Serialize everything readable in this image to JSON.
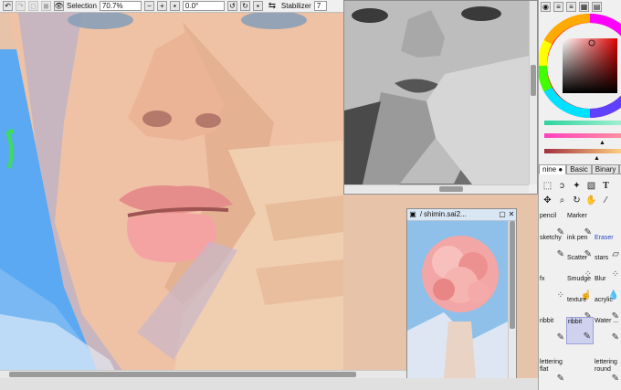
{
  "toolbar": {
    "selection_label": "Selection",
    "zoom": "70.7%",
    "rotation": "0.0°",
    "stabilizer_label": "Stabilizer",
    "stabilizer_value": "7"
  },
  "navigator": {
    "title": "shimin.sai2..."
  },
  "panel": {
    "tabs": [
      "nine ●",
      "Basic",
      "Binary",
      "Ve"
    ],
    "brushes": [
      {
        "label": "pencil",
        "glyph": "✎"
      },
      {
        "label": "Marker",
        "glyph": "✎"
      },
      {
        "label": "",
        "glyph": ""
      },
      {
        "label": "sketchy",
        "glyph": "✎"
      },
      {
        "label": "ink pen",
        "glyph": "✎"
      },
      {
        "label": "Eraser",
        "glyph": "▱"
      },
      {
        "label": "",
        "glyph": ""
      },
      {
        "label": "Scatter",
        "glyph": "⁘"
      },
      {
        "label": "stars",
        "glyph": "⁘"
      },
      {
        "label": "fx",
        "glyph": "⁘"
      },
      {
        "label": "Smudge",
        "glyph": "☝"
      },
      {
        "label": "Blur",
        "glyph": "💧"
      },
      {
        "label": "",
        "glyph": ""
      },
      {
        "label": "texture",
        "glyph": "✎"
      },
      {
        "label": "acrylic",
        "glyph": "✎"
      },
      {
        "label": "ribbit",
        "glyph": "✎"
      },
      {
        "label": "ribbit",
        "glyph": "✎"
      },
      {
        "label": "Water ...",
        "glyph": "✎"
      },
      {
        "label": "lettering flat",
        "glyph": "✎"
      },
      {
        "label": "",
        "glyph": ""
      },
      {
        "label": "lettering round",
        "glyph": "✎"
      }
    ]
  },
  "colors": {
    "canvas_blue": "#5aa9f2",
    "skin": "#f2c2a4",
    "accent_selection": "#cfd2ee",
    "eraser_blue": "#2646c8"
  }
}
